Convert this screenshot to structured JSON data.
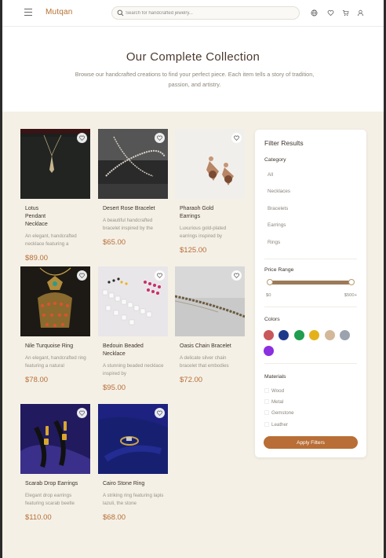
{
  "header": {
    "brand": "Mutqan",
    "search_placeholder": "Search for handcrafted jewelry...",
    "icons": [
      "menu-icon",
      "search-icon",
      "globe-icon",
      "heart-icon",
      "cart-icon",
      "user-icon"
    ]
  },
  "hero": {
    "title": "Our Complete Collection",
    "subtitle": "Browse our handcrafted creations to find your perfect piece. Each item tells a story of tradition, passion, and artistry."
  },
  "products": [
    {
      "name": "Lotus Pendant Necklace",
      "desc": "An elegant, handcrafted necklace featuring a",
      "price": "$89.00"
    },
    {
      "name": "Desert Rose Bracelet",
      "desc": "A beautiful handcrafted bracelet inspired by the",
      "price": "$65.00"
    },
    {
      "name": "Pharaoh Gold Earrings",
      "desc": "Luxurious gold-plated earrings inspired by",
      "price": "$125.00"
    },
    {
      "name": "Nile Turquoise Ring",
      "desc": "An elegant, handcrafted ring featuring a natural",
      "price": "$78.00"
    },
    {
      "name": "Bedouin Beaded Necklace",
      "desc": "A stunning beaded necklace inspired by",
      "price": "$95.00"
    },
    {
      "name": "Oasis Chain Bracelet",
      "desc": "A delicate silver chain bracelet that embodies",
      "price": "$72.00"
    },
    {
      "name": "Scarab Drop Earrings",
      "desc": "Elegant drop earrings featuring scarab beetle",
      "price": "$110.00"
    },
    {
      "name": "Cairo Stone Ring",
      "desc": "A striking ring featuring lapis lazuli, the stone",
      "price": "$68.00"
    }
  ],
  "filters": {
    "title": "Filter Results",
    "category_label": "Category",
    "categories": [
      "All",
      "Necklaces",
      "Bracelets",
      "Earrings",
      "Rings"
    ],
    "price_label": "Price Range",
    "price_min": "$0",
    "price_max": "$500+",
    "colors_label": "Colors",
    "colors": [
      "#c9585a",
      "#1f3a8a",
      "#1e9e4e",
      "#e3b21b",
      "#d3b99a",
      "#9ca3af",
      "#8b2fe0"
    ],
    "materials_label": "Materials",
    "materials": [
      "Wood",
      "Metal",
      "Gemstone",
      "Leather"
    ],
    "apply_label": "Apply Filters"
  }
}
